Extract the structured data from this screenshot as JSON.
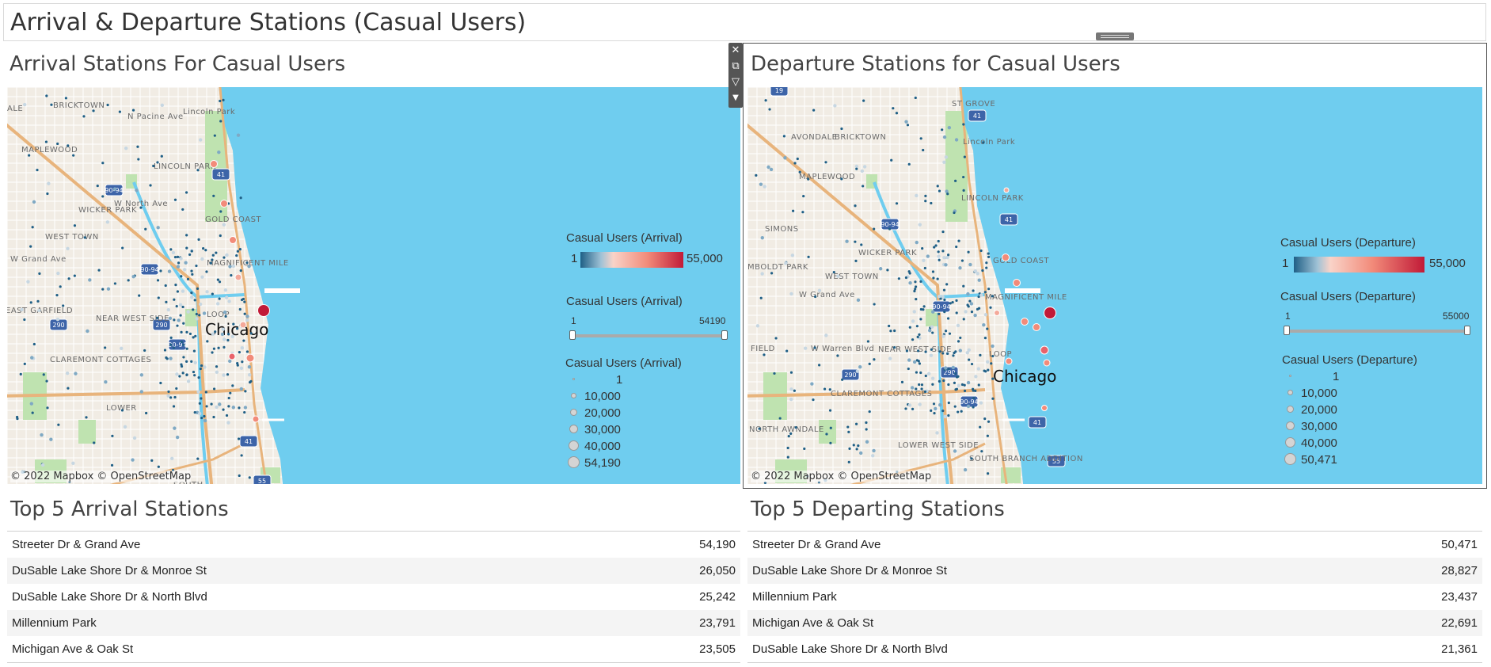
{
  "dashboard": {
    "title": "Arrival & Departure Stations (Casual Users)"
  },
  "toolbar": {
    "icons": [
      "close-icon",
      "popout-icon",
      "filter-icon",
      "dropdown-icon"
    ]
  },
  "arrival": {
    "map_title": "Arrival Stations For Casual Users",
    "credit": "© 2022 Mapbox © OpenStreetMap",
    "labels": [
      "BRICKTOWN",
      "N Pacine Ave",
      "Lincoln Park",
      "MAPLEWOOD",
      "LINCOLN PARK",
      "WICKER PARK",
      "W North Ave",
      "GOLD COAST",
      "WEST TOWN",
      "W Grand Ave",
      "MAGNIFICENT MILE",
      "EAST GARFIELD",
      "NEAR WEST SIDE",
      "LOOP",
      "Chicago",
      "CLAREMONT COTTAGES",
      "LOWER",
      "SOUTH",
      "ALE"
    ],
    "highways": [
      "41",
      "90-94",
      "90-94",
      "290",
      "290",
      "90-94",
      "41",
      "55"
    ],
    "color_legend": {
      "title": "Casual Users (Arrival)",
      "min": "1",
      "max": "55,000"
    },
    "slider_legend": {
      "title": "Casual Users (Arrival)",
      "min": "1",
      "max": "54190"
    },
    "size_legend": {
      "title": "Casual Users (Arrival)",
      "items": [
        "1",
        "10,000",
        "20,000",
        "30,000",
        "40,000",
        "54,190"
      ]
    },
    "table_title": "Top 5 Arrival Stations",
    "rows": [
      {
        "name": "Streeter Dr & Grand Ave",
        "value": "54,190"
      },
      {
        "name": "DuSable Lake Shore Dr & Monroe St",
        "value": "26,050"
      },
      {
        "name": "DuSable Lake Shore Dr & North Blvd",
        "value": "25,242"
      },
      {
        "name": "Millennium Park",
        "value": "23,791"
      },
      {
        "name": "Michigan Ave & Oak St",
        "value": "23,505"
      }
    ]
  },
  "departure": {
    "map_title": "Departure Stations for Casual Users",
    "credit": "© 2022 Mapbox © OpenStreetMap",
    "labels": [
      "AVONDALE",
      "BRICKTOWN",
      "Lincoln Park",
      "MAPLEWOOD",
      "LINCOLN PARK",
      "SIMONS",
      "WICKER PARK",
      "GOLD COAST",
      "MBOLDT PARK",
      "WEST TOWN",
      "W Grand Ave",
      "MAGNIFICENT MILE",
      "W Warren Blvd",
      "NEAR WEST SIDE",
      "LOOP",
      "Chicago",
      "CLAREMONT COTTAGES",
      "NORTH AWNDALE",
      "LOWER WEST SIDE",
      "SOUTH BRANCH ADDITION",
      "FIELD",
      "ST GROVE"
    ],
    "highways": [
      "19",
      "41",
      "90-94",
      "41",
      "90-94",
      "290",
      "290",
      "90-94",
      "41",
      "55"
    ],
    "color_legend": {
      "title": "Casual Users (Departure)",
      "min": "1",
      "max": "55,000"
    },
    "slider_legend": {
      "title": "Casual Users (Departure)",
      "min": "1",
      "max": "55000"
    },
    "size_legend": {
      "title": "Casual Users (Departure)",
      "items": [
        "1",
        "10,000",
        "20,000",
        "30,000",
        "40,000",
        "50,471"
      ]
    },
    "table_title": "Top 5 Departing Stations",
    "rows": [
      {
        "name": "Streeter Dr & Grand Ave",
        "value": "50,471"
      },
      {
        "name": "DuSable Lake Shore Dr & Monroe St",
        "value": "28,827"
      },
      {
        "name": "Millennium Park",
        "value": "23,437"
      },
      {
        "name": "Michigan Ave & Oak St",
        "value": "22,691"
      },
      {
        "name": "DuSable Lake Shore Dr & North Blvd",
        "value": "21,361"
      }
    ]
  },
  "colors": {
    "lake": "#6fcdef",
    "land": "#f1ece4",
    "park": "#bfe3b0",
    "highway": "#e8b47c",
    "ramp_low": "#1f5f86",
    "ramp_mid": "#f4a99a",
    "ramp_high": "#c11a37"
  }
}
